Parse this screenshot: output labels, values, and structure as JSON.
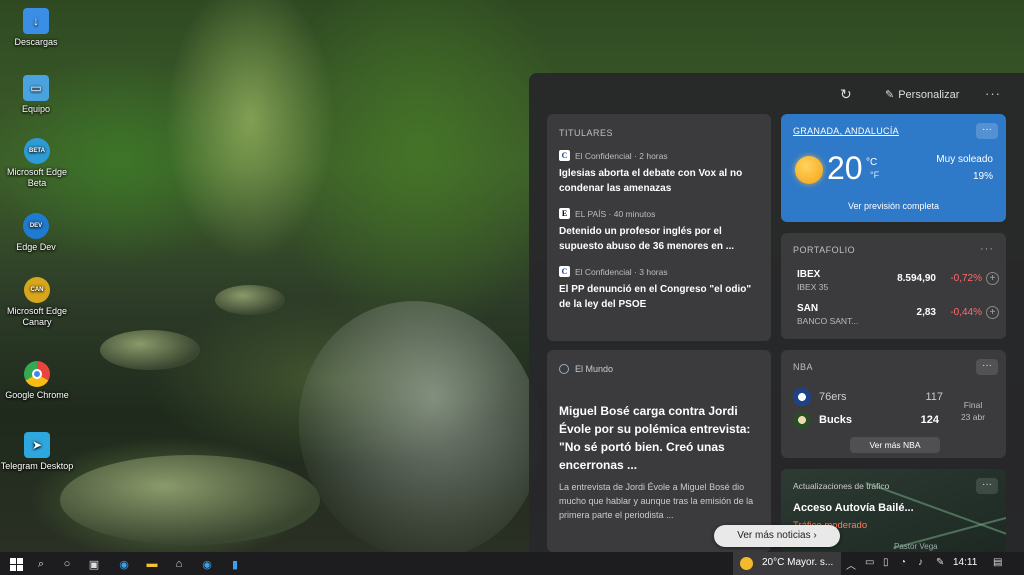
{
  "desktop": {
    "icons": [
      {
        "label": "Descargas",
        "icon": "download-icon",
        "color": "#3a8ee6"
      },
      {
        "label": "Equipo",
        "icon": "computer-icon",
        "color": "#4aa3df"
      },
      {
        "label": "Microsoft Edge Beta",
        "icon": "edge-beta-icon",
        "color": "#2e9bd6",
        "badge": "BETA"
      },
      {
        "label": "Edge Dev",
        "icon": "edge-dev-icon",
        "color": "#1f7bd0",
        "badge": "DEV"
      },
      {
        "label": "Microsoft Edge Canary",
        "icon": "edge-canary-icon",
        "color": "#d8a61c",
        "badge": "CAN"
      },
      {
        "label": "Google Chrome",
        "icon": "chrome-icon",
        "color": "#e8453c"
      },
      {
        "label": "Telegram Desktop",
        "icon": "telegram-icon",
        "color": "#2ea6de"
      }
    ]
  },
  "widgets": {
    "toolbar": {
      "personalize_label": "Personalizar",
      "more_label": "···"
    },
    "headlines": {
      "title": "TITULARES",
      "items": [
        {
          "logo": "C",
          "source": "El Confidencial · 2 horas",
          "text": "Iglesias aborta el debate con Vox al no condenar las amenazas"
        },
        {
          "logo": "E",
          "source": "EL PAÍS · 40 minutos",
          "text": "Detenido un profesor inglés por el supuesto abuso de 36 menores en ..."
        },
        {
          "logo": "C",
          "source": "El Confidencial · 3 horas",
          "text": "El PP denunció en el Congreso \"el odio\" de la ley del PSOE"
        }
      ]
    },
    "weather": {
      "location": "GRANADA, ANDALUCÍA",
      "temp": "20",
      "unit_c": "°C",
      "unit_f": "°F",
      "condition": "Muy soleado",
      "precip": "19%",
      "forecast_link": "Ver previsión completa",
      "more_label": "···",
      "card_color": "#2f79c9"
    },
    "portfolio": {
      "title": "PORTAFOLIO",
      "more_label": "···",
      "stocks": [
        {
          "symbol": "IBEX",
          "name": "IBEX 35",
          "price": "8.594,90",
          "change": "-0,72%",
          "add": "+"
        },
        {
          "symbol": "SAN",
          "name": "BANCO SANT...",
          "price": "2,83",
          "change": "-0,44%",
          "add": "+"
        }
      ]
    },
    "news": {
      "source": "El Mundo",
      "headline": "Miguel Bosé carga contra Jordi Évole por su polémica entrevista: \"No sé portó bien. Creó unas encerronas ...",
      "body": "La entrevista de Jordi Évole a Miguel Bosé dio mucho que hablar y aunque tras la emisión de la primera parte el periodista ..."
    },
    "nba": {
      "title": "NBA",
      "more_label": "···",
      "teams": [
        {
          "name": "76ers",
          "score": "117",
          "color": "#1d428a"
        },
        {
          "name": "Bucks",
          "score": "124",
          "color": "#2a4a2a"
        }
      ],
      "status": "Final",
      "date": "23 abr",
      "more_link": "Ver más NBA"
    },
    "traffic": {
      "title": "Actualizaciones de tráfico",
      "road": "Acceso Autovía Bailé...",
      "status": "Tráfico moderado",
      "place": "Pastor Vega",
      "more_label": "···"
    },
    "see_more_news": "Ver más noticias"
  },
  "taskbar": {
    "weather_text": "20°C  Mayor. s...",
    "time": "14:11"
  }
}
